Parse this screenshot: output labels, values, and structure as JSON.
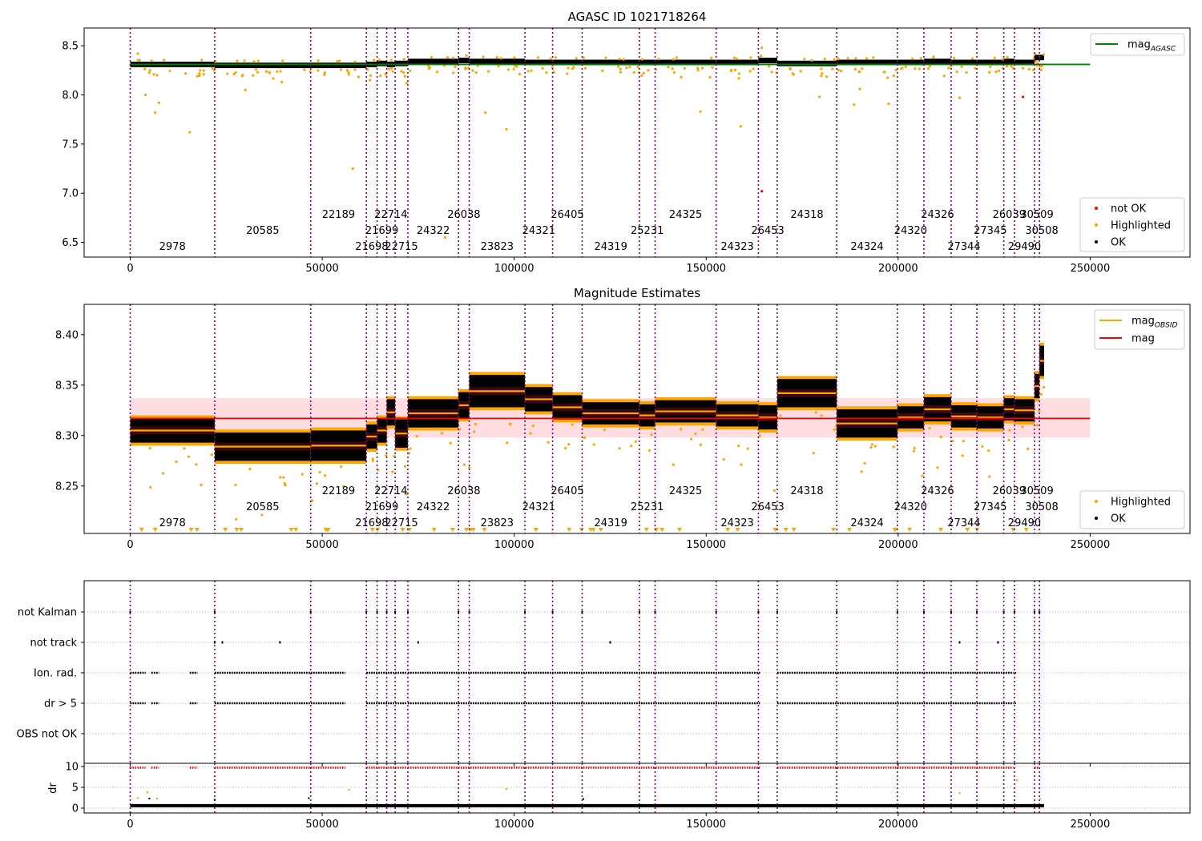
{
  "chart_data": [
    {
      "type": "scatter",
      "title": "AGASC ID 1021718264",
      "xlim": [
        -12000,
        276000
      ],
      "ylim": [
        6.35,
        8.68
      ],
      "x_ticks": [
        0,
        50000,
        100000,
        150000,
        200000,
        250000
      ],
      "y_ticks": [
        6.5,
        7.0,
        7.5,
        8.0,
        8.5
      ],
      "mag_agasc": 8.31,
      "legend_top": [
        {
          "label": "mag",
          "sub": "AGASC",
          "color": "#008000",
          "kind": "line"
        }
      ],
      "legend_bottom": [
        {
          "label": "not OK",
          "color": "#ff0000",
          "kind": "dot"
        },
        {
          "label": "Highlighted",
          "color": "#ffa500",
          "kind": "dot"
        },
        {
          "label": "OK",
          "color": "#000000",
          "kind": "dot"
        }
      ],
      "notok_points": [
        [
          164500,
          7.02
        ],
        [
          232500,
          7.98
        ]
      ],
      "outlier_points": [
        [
          2000,
          8.42
        ],
        [
          4000,
          8.0
        ],
        [
          6500,
          7.82
        ],
        [
          7500,
          7.92
        ],
        [
          15500,
          7.62
        ],
        [
          58000,
          7.25
        ],
        [
          92500,
          7.82
        ],
        [
          98000,
          7.65
        ],
        [
          148500,
          7.83
        ],
        [
          159000,
          7.68
        ],
        [
          164500,
          8.48
        ],
        [
          179500,
          7.98
        ],
        [
          188500,
          7.9
        ],
        [
          193500,
          8.38
        ],
        [
          197500,
          7.91
        ],
        [
          216000,
          7.97
        ],
        [
          82000,
          6.55
        ],
        [
          190000,
          8.06
        ],
        [
          30000,
          8.05
        ],
        [
          72000,
          8.12
        ]
      ],
      "segment_levels": [
        8.31,
        8.3,
        8.3,
        8.31,
        8.32,
        8.31,
        8.32,
        8.34,
        8.35,
        8.34,
        8.33,
        8.33,
        8.33,
        8.33,
        8.33,
        8.33,
        8.35,
        8.32,
        8.33,
        8.33,
        8.34,
        8.33,
        8.33,
        8.34,
        8.33,
        8.38,
        8.38,
        8.35
      ]
    },
    {
      "type": "scatter",
      "title": "Magnitude Estimates",
      "xlim": [
        -12000,
        276000
      ],
      "ylim": [
        8.203,
        8.43
      ],
      "x_ticks": [
        0,
        50000,
        100000,
        150000,
        200000,
        250000
      ],
      "y_ticks": [
        8.25,
        8.3,
        8.35,
        8.4
      ],
      "mag": 8.317,
      "mag_band": [
        8.298,
        8.337
      ],
      "legend_top": [
        {
          "label": "mag",
          "sub": "OBSID",
          "color": "#ffa500",
          "kind": "line"
        },
        {
          "label": "mag",
          "sub": "",
          "color": "#ff0000",
          "kind": "line"
        }
      ],
      "legend_bottom": [
        {
          "label": "Highlighted",
          "color": "#ffa500",
          "kind": "dot"
        },
        {
          "label": "OK",
          "color": "#000000",
          "kind": "dot"
        }
      ],
      "mag_obsid": [
        8.305,
        8.289,
        8.29,
        8.299,
        8.305,
        8.323,
        8.302,
        8.322,
        8.33,
        8.344,
        8.336,
        8.328,
        8.322,
        8.32,
        8.324,
        8.32,
        8.318,
        8.342,
        8.312,
        8.318,
        8.326,
        8.319,
        8.318,
        8.326,
        8.325,
        8.349,
        8.374,
        8.347
      ],
      "segment_spread": [
        0.012,
        0.014,
        0.015,
        0.012,
        0.012,
        0.013,
        0.014,
        0.014,
        0.013,
        0.016,
        0.012,
        0.012,
        0.011,
        0.011,
        0.011,
        0.011,
        0.012,
        0.014,
        0.014,
        0.011,
        0.012,
        0.011,
        0.011,
        0.011,
        0.011,
        0.012,
        0.015,
        0.012
      ]
    },
    {
      "type": "scatter",
      "title": "",
      "xlim": [
        -12000,
        276000
      ],
      "categories": [
        "not Kalman",
        "not track",
        "Ion. rad.",
        "dr > 5",
        "OBS not OK"
      ],
      "dr_ylabel": "dr",
      "dr_ticks": [
        0,
        5,
        10
      ],
      "x_ticks": [
        0,
        50000,
        100000,
        150000,
        200000,
        250000
      ]
    }
  ],
  "obsids": [
    {
      "id": "2978",
      "start": 0,
      "end": 22000
    },
    {
      "id": "20585",
      "start": 22000,
      "end": 47000
    },
    {
      "id": "22189",
      "start": 47000,
      "end": 61500
    },
    {
      "id": "21698",
      "start": 61500,
      "end": 64300
    },
    {
      "id": "21699",
      "start": 64300,
      "end": 66800
    },
    {
      "id": "22714",
      "start": 66800,
      "end": 69000
    },
    {
      "id": "22715",
      "start": 69000,
      "end": 72300
    },
    {
      "id": "24322",
      "start": 72300,
      "end": 85500
    },
    {
      "id": "26038",
      "start": 85500,
      "end": 88300
    },
    {
      "id": "23823",
      "start": 88300,
      "end": 102800
    },
    {
      "id": "24321",
      "start": 102800,
      "end": 110000
    },
    {
      "id": "26405",
      "start": 110000,
      "end": 117700
    },
    {
      "id": "24319",
      "start": 117700,
      "end": 132600
    },
    {
      "id": "25231",
      "start": 132600,
      "end": 136700
    },
    {
      "id": "24325",
      "start": 136700,
      "end": 152600
    },
    {
      "id": "24323",
      "start": 152600,
      "end": 163600
    },
    {
      "id": "26453",
      "start": 163600,
      "end": 168500
    },
    {
      "id": "24318",
      "start": 168500,
      "end": 184000
    },
    {
      "id": "24324",
      "start": 184000,
      "end": 199800
    },
    {
      "id": "24320",
      "start": 199800,
      "end": 206700
    },
    {
      "id": "24326",
      "start": 206700,
      "end": 213800
    },
    {
      "id": "27344",
      "start": 213800,
      "end": 220500
    },
    {
      "id": "27345",
      "start": 220500,
      "end": 227500
    },
    {
      "id": "26039",
      "start": 227500,
      "end": 230300
    },
    {
      "id": "29490",
      "start": 230300,
      "end": 235500
    },
    {
      "id": "30509",
      "start": 235500,
      "end": 236800
    },
    {
      "id": "30508",
      "start": 236800,
      "end": 238000
    }
  ],
  "obsid_label_rows": [
    2,
    1,
    0,
    2,
    1,
    0,
    2,
    1,
    0,
    2,
    1,
    0,
    2,
    1,
    0,
    2,
    1,
    0,
    2,
    1,
    0,
    2,
    1,
    0,
    2,
    0,
    1
  ],
  "colors": {
    "ok": "#000000",
    "highlighted": "#ffa500",
    "not_ok": "#ff0000",
    "agasc_line": "#008000",
    "obs_boundary": "#800080",
    "mag_band": "#ffdde0"
  }
}
